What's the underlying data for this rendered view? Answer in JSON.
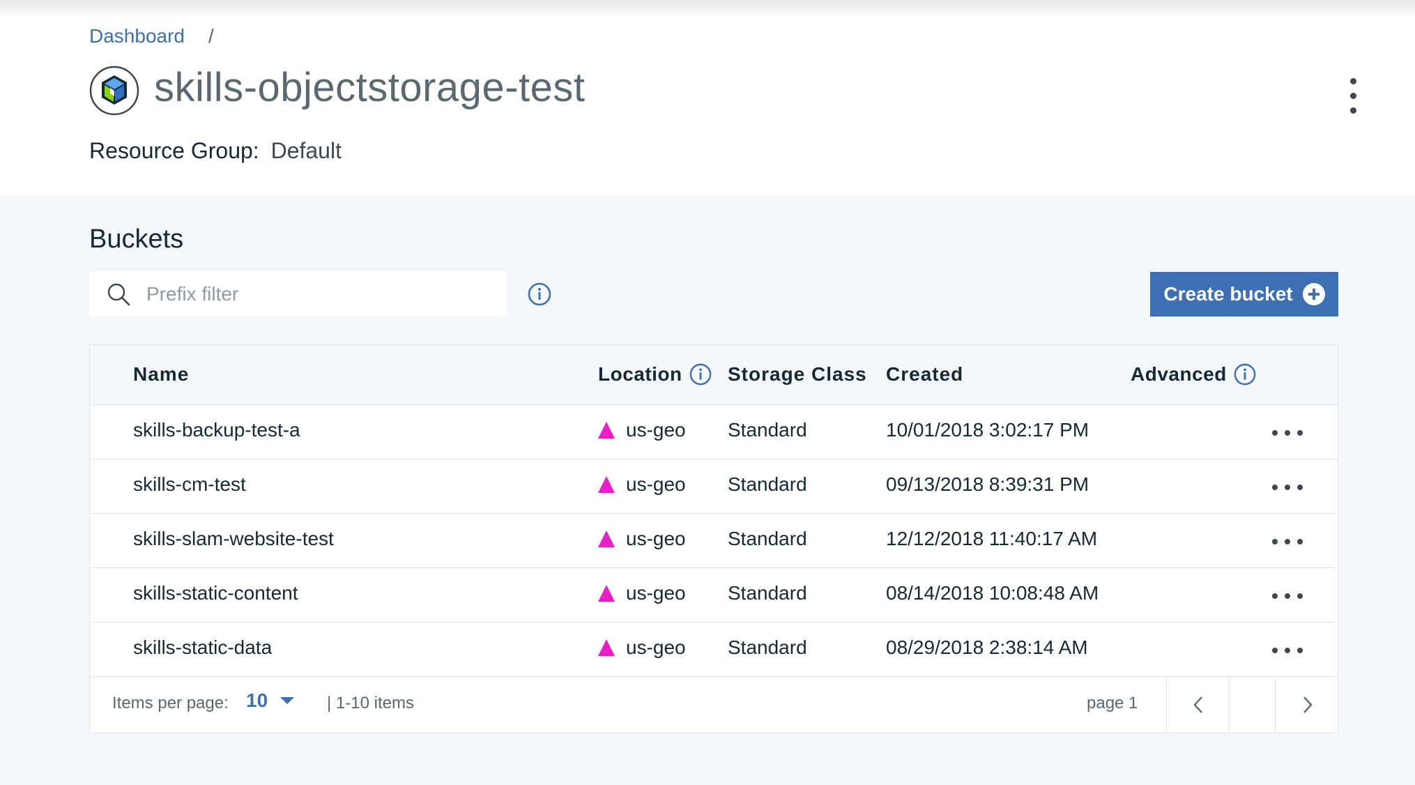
{
  "breadcrumb": {
    "link": "Dashboard",
    "separator": "/"
  },
  "header": {
    "title": "skills-objectstorage-test",
    "resource_group_label": "Resource Group:",
    "resource_group_value": "Default"
  },
  "buckets": {
    "title": "Buckets",
    "search_placeholder": "Prefix filter",
    "create_label": "Create bucket"
  },
  "table": {
    "columns": {
      "name": "Name",
      "location": "Location",
      "storage_class": "Storage Class",
      "created": "Created",
      "advanced": "Advanced"
    },
    "rows": [
      {
        "name": "skills-backup-test-a",
        "location": "us-geo",
        "storage_class": "Standard",
        "created": "10/01/2018 3:02:17 PM"
      },
      {
        "name": "skills-cm-test",
        "location": "us-geo",
        "storage_class": "Standard",
        "created": "09/13/2018 8:39:31 PM"
      },
      {
        "name": "skills-slam-website-test",
        "location": "us-geo",
        "storage_class": "Standard",
        "created": "12/12/2018 11:40:17 AM"
      },
      {
        "name": "skills-static-content",
        "location": "us-geo",
        "storage_class": "Standard",
        "created": "08/14/2018 10:08:48 AM"
      },
      {
        "name": "skills-static-data",
        "location": "us-geo",
        "storage_class": "Standard",
        "created": "08/29/2018 2:38:14 AM"
      }
    ]
  },
  "pagination": {
    "items_per_page_label": "Items per page:",
    "items_per_page_value": "10",
    "range": "|  1-10 items",
    "page": "page 1"
  },
  "colors": {
    "accent": "#3d70b2",
    "location_marker": "#e81ec8"
  },
  "icons": [
    "cos-service-icon",
    "overflow-menu-icon",
    "search-icon",
    "info-icon",
    "add-icon",
    "location-triangle-icon",
    "row-overflow-icon",
    "chevron-down-icon",
    "chevron-left-icon",
    "chevron-right-icon"
  ]
}
